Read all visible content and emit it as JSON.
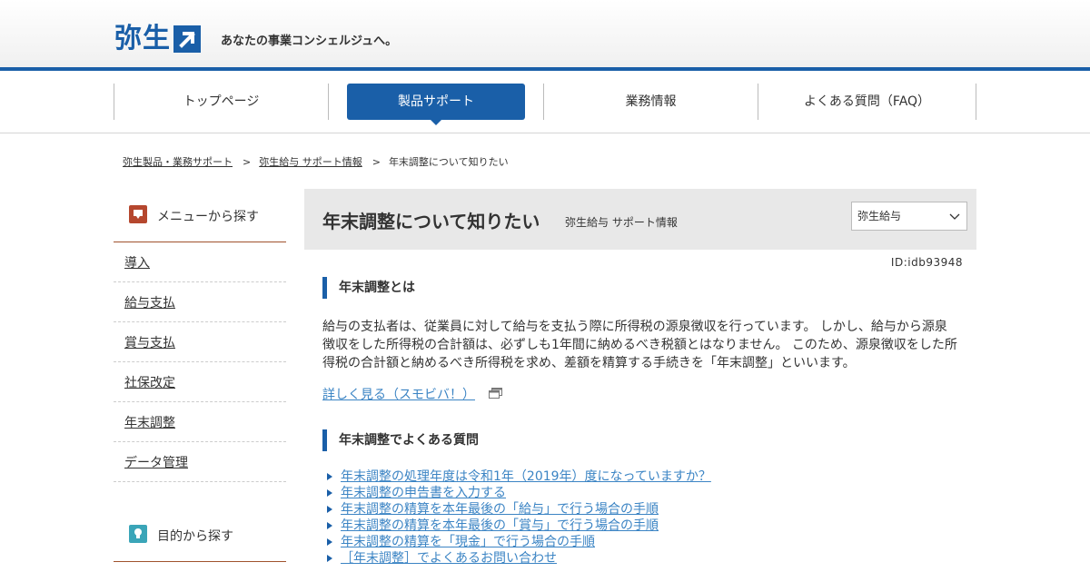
{
  "brand": {
    "logo_text": "弥生",
    "tagline": "あなたの事業コンシェルジュへ。",
    "brand_color": "#1a5fa8"
  },
  "gnav": {
    "items": [
      {
        "label": "トップページ",
        "active": false
      },
      {
        "label": "製品サポート",
        "active": true
      },
      {
        "label": "業務情報",
        "active": false
      },
      {
        "label": "よくある質問（FAQ）",
        "active": false
      }
    ]
  },
  "breadcrumb": {
    "items": [
      "弥生製品・業務サポート",
      "弥生給与 サポート情報",
      "年末調整について知りたい"
    ],
    "separator": ">"
  },
  "sidebar": {
    "menu_title": "メニューから探す",
    "menu_icon": "monitor-icon",
    "menu_icon_color": "#b5472e",
    "items": [
      "導入",
      "給与支払",
      "賞与支払",
      "社保改定",
      "年末調整",
      "データ管理"
    ],
    "purpose_title": "目的から探す",
    "purpose_icon": "lightbulb-icon",
    "purpose_icon_color": "#3aa5b8"
  },
  "main": {
    "title": "年末調整について知りたい",
    "subtitle": "弥生給与 サポート情報",
    "product_select": "弥生給与",
    "doc_id": "ID:idb93948",
    "section1_heading": "年末調整とは",
    "section1_body": "給与の支払者は、従業員に対して給与を支払う際に所得税の源泉徴収を行っています。 しかし、給与から源泉徴収をした所得税の合計額は、必ずしも1年間に納めるべき税額とはなりません。 このため、源泉徴収をした所得税の合計額と納めるべき所得税を求め、差額を精算する手続きを「年末調整」といいます。",
    "more_link": "詳しく見る（スモビバ！）",
    "section2_heading": "年末調整でよくある質問",
    "faq": [
      "年末調整の処理年度は令和1年（2019年）度になっていますか？",
      "年末調整の申告書を入力する",
      "年末調整の精算を本年最後の「給与」で行う場合の手順",
      "年末調整の精算を本年最後の「賞与」で行う場合の手順",
      "年末調整の精算を「現金」で行う場合の手順",
      "［年末調整］でよくあるお問い合わせ"
    ],
    "link_color": "#3b84c4"
  }
}
